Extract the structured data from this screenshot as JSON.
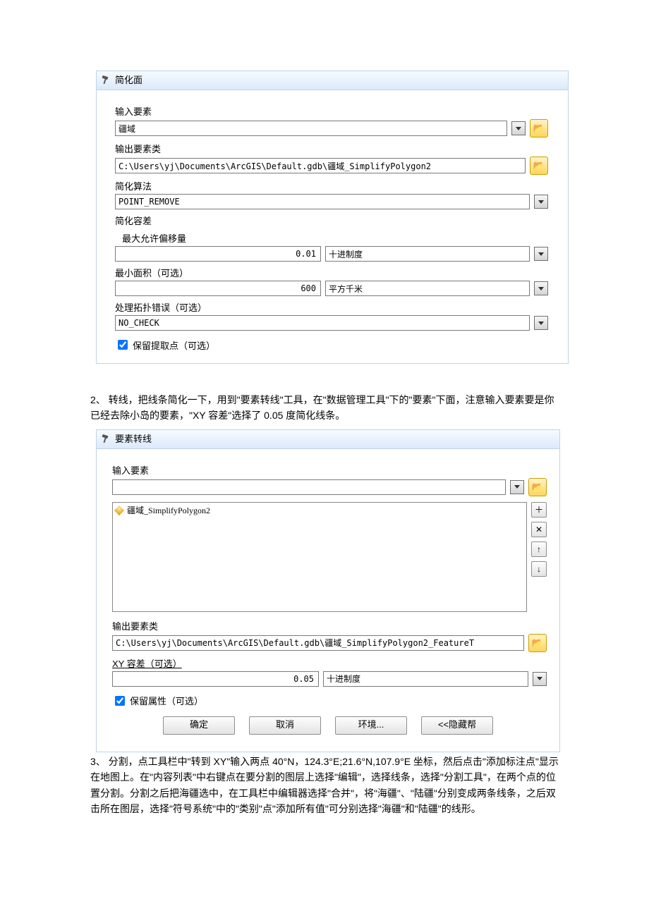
{
  "dialog1": {
    "title": "简化面",
    "input_label": "输入要素",
    "input_value": "疆域",
    "output_label": "输出要素类",
    "output_value": "C:\\Users\\yj\\Documents\\ArcGIS\\Default.gdb\\疆域_SimplifyPolygon2",
    "algo_label": "简化算法",
    "algo_value": "POINT_REMOVE",
    "tol_label": "简化容差",
    "maxoffset_label": "最大允许偏移量",
    "maxoffset_value": "0.01",
    "maxoffset_unit": "十进制度",
    "minarea_label": "最小面积（可选）",
    "minarea_value": "600",
    "minarea_unit": "平方千米",
    "topo_label": "处理拓扑错误（可选）",
    "topo_value": "NO_CHECK",
    "keep_pts_label": "保留提取点（可选）",
    "keep_pts_checked": true
  },
  "paragraph2": "2、 转线，把线条简化一下，用到\"要素转线\"工具，在\"数据管理工具\"下的\"要素\"下面，注意输入要素要是你已经去除小岛的要素，\"XY 容差\"选择了 0.05 度简化线条。",
  "dialog2": {
    "title": "要素转线",
    "input_label": "输入要素",
    "list_item": "疆域_SimplifyPolygon2",
    "output_label": "输出要素类",
    "output_value": "C:\\Users\\yj\\Documents\\ArcGIS\\Default.gdb\\疆域_SimplifyPolygon2_FeatureT",
    "xytol_label": "XY 容差（可选）",
    "xytol_value": "0.05",
    "xytol_unit": "十进制度",
    "keep_attr_label": "保留属性（可选）",
    "keep_attr_checked": true,
    "btn_ok": "确定",
    "btn_cancel": "取消",
    "btn_env": "环境...",
    "btn_hide": "<<隐藏帮"
  },
  "paragraph3": "3、 分割，点工具栏中\"转到 XY\"输入两点 40°N，124.3°E;21.6°N,107.9°E 坐标，然后点击\"添加标注点\"显示在地图上。在\"内容列表\"中右键点在要分割的图层上选择\"编辑\"，选择线条，选择\"分割工具\"，在两个点的位置分割。分割之后把海疆选中，在工具栏中编辑器选择\"合并\"，将\"海疆\"、\"陆疆\"分别变成两条线条，之后双击所在图层，选择\"符号系统\"中的\"类别\"点\"添加所有值\"可分别选择\"海疆\"和\"陆疆\"的线形。"
}
